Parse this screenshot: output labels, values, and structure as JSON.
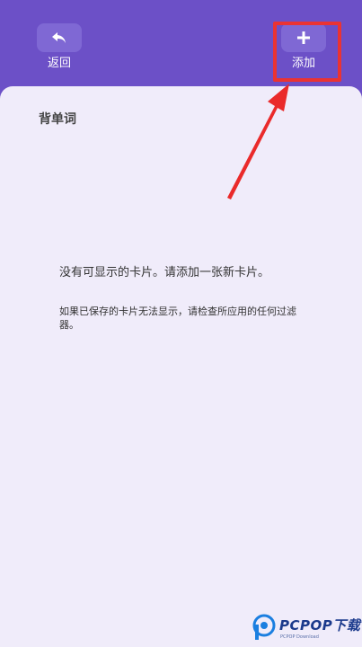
{
  "header": {
    "back_label": "返回",
    "add_label": "添加",
    "back_icon": "undo-arrow-icon",
    "add_icon": "plus-icon"
  },
  "deck": {
    "title": "背单词"
  },
  "empty_state": {
    "message": "没有可显示的卡片。请添加一张新卡片。",
    "hint": "如果已保存的卡片无法显示，请检查所应用的任何过滤器。"
  },
  "watermark": {
    "text": "PCPOP下载",
    "subtext": "PCPOP Download"
  },
  "colors": {
    "header_bg": "#6c50c7",
    "button_bg": "#7f68d4",
    "card_bg": "#f0ecfa",
    "highlight": "#ea3333"
  }
}
